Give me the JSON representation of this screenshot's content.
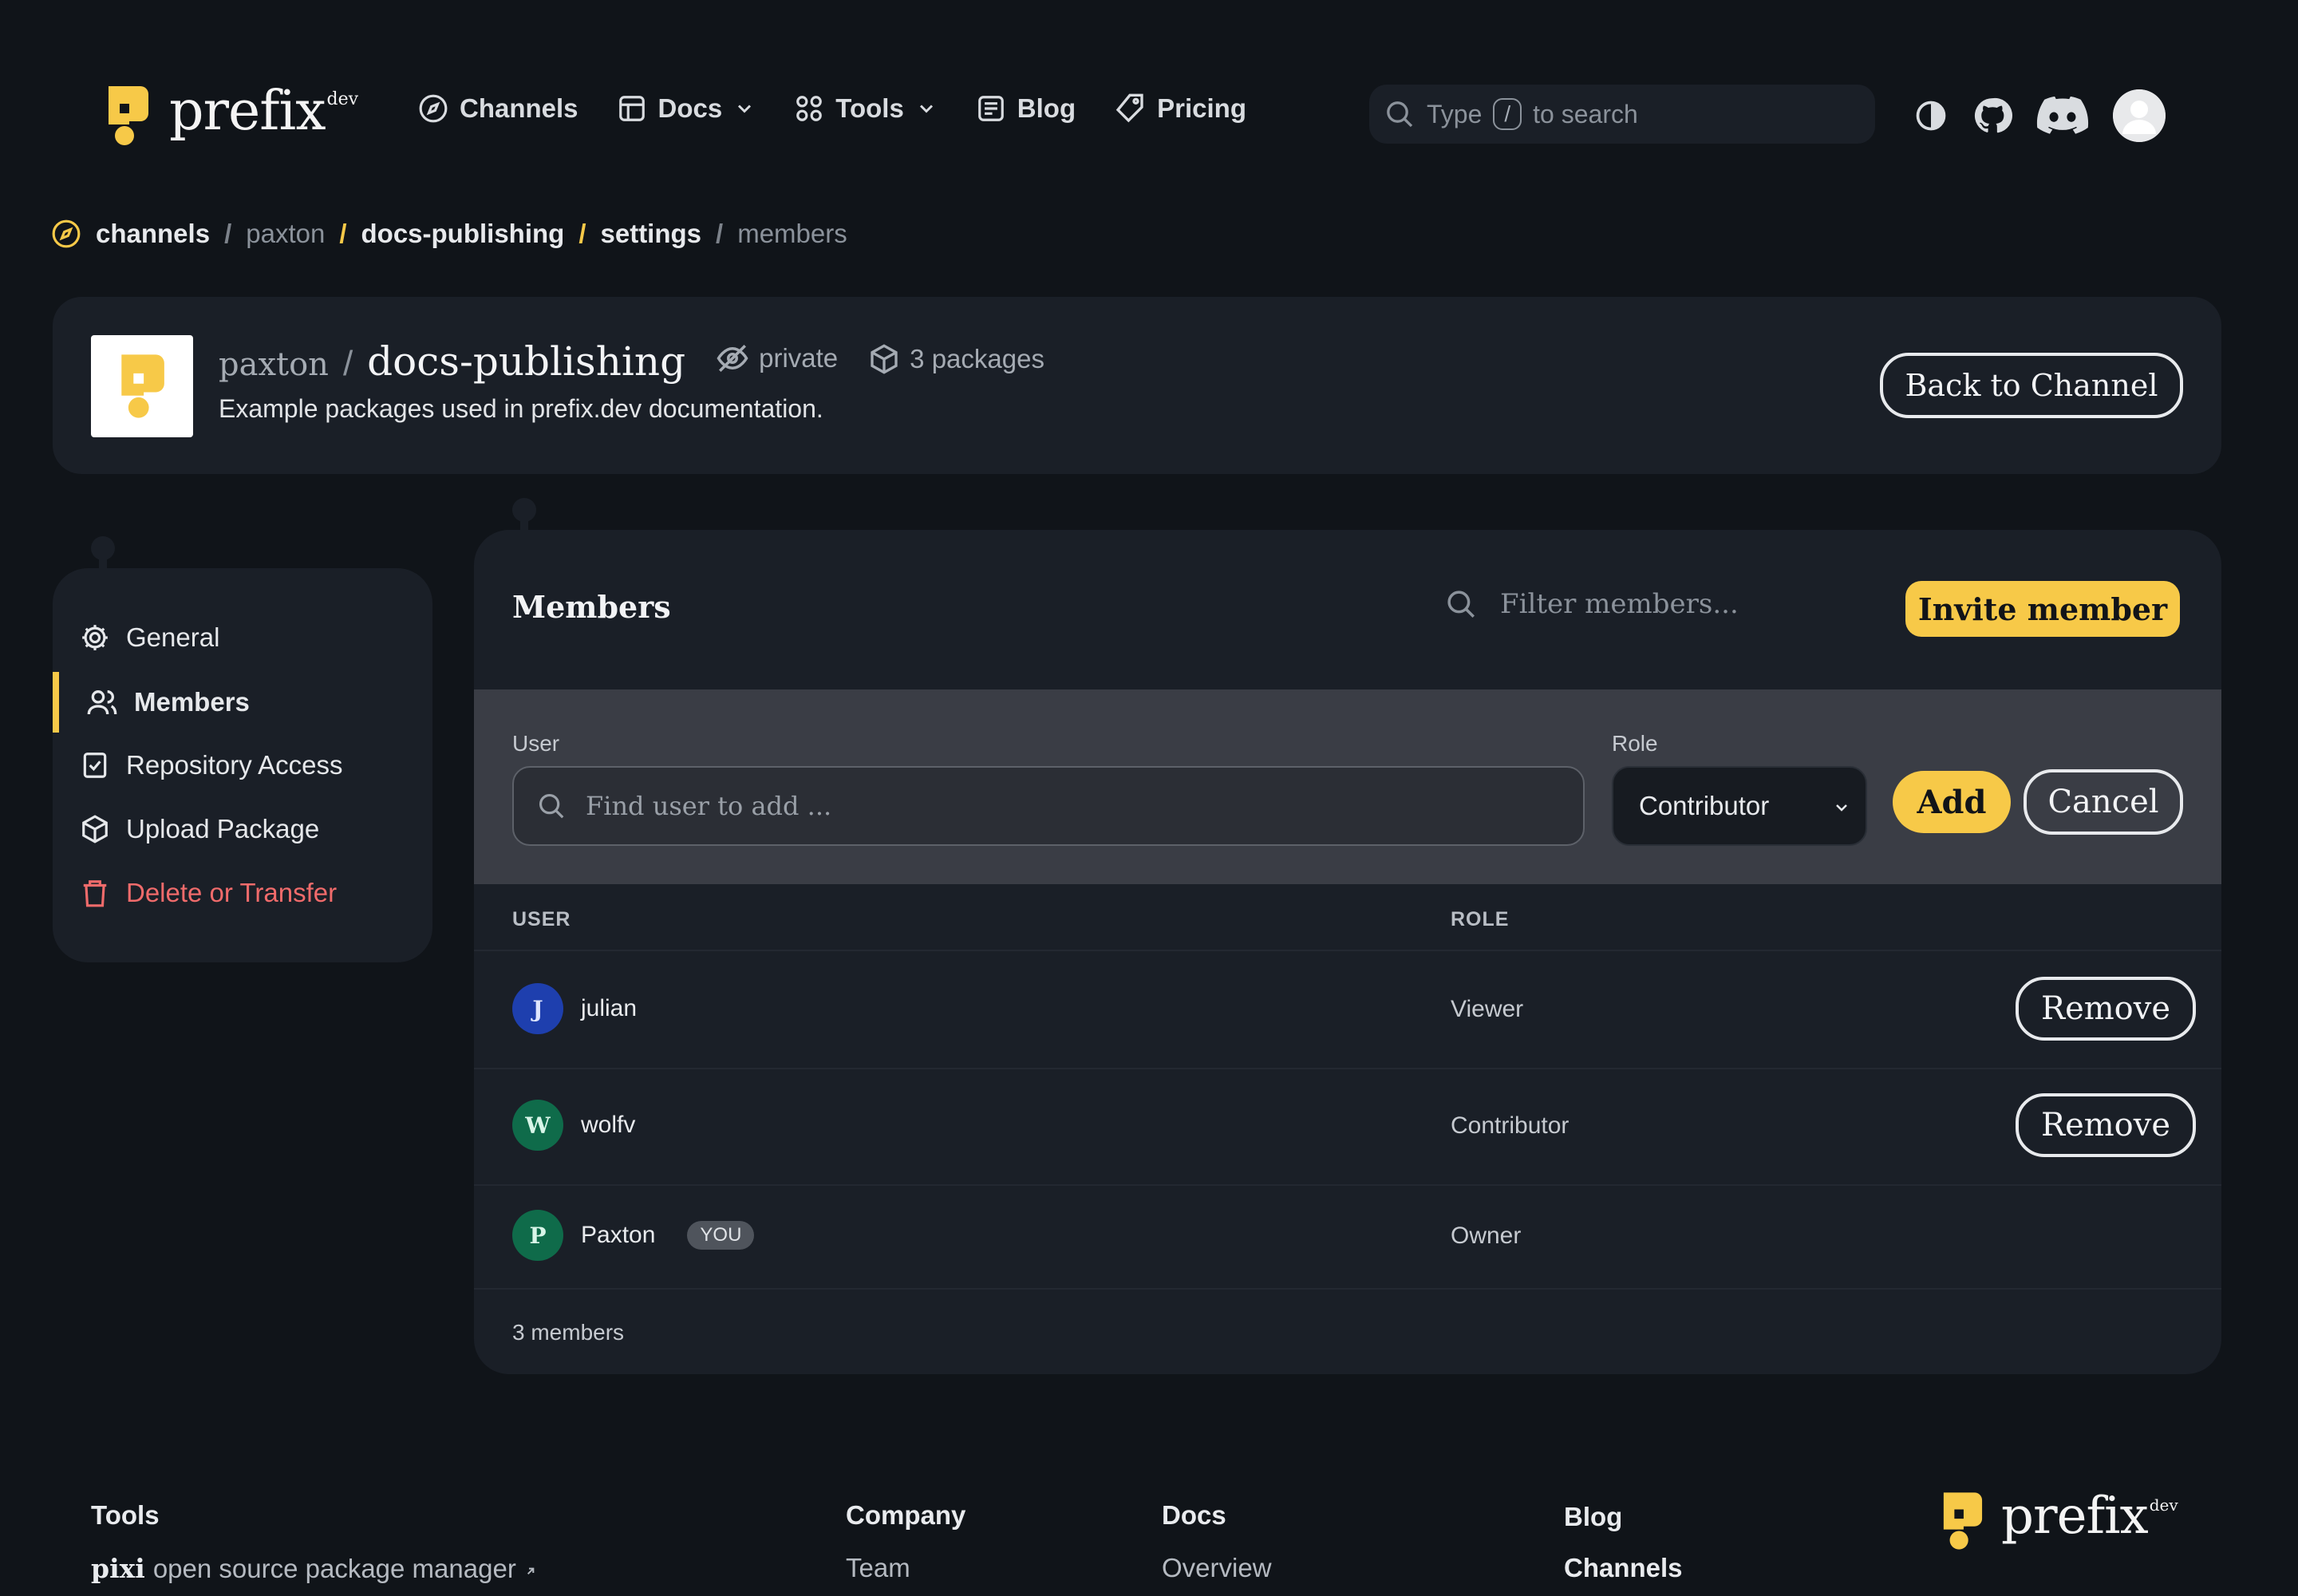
{
  "brand": {
    "name": "prefix",
    "sup": "dev",
    "accent": "#f7c948"
  },
  "nav": {
    "items": [
      {
        "label": "Channels",
        "icon": "compass-icon"
      },
      {
        "label": "Docs",
        "icon": "book-icon"
      },
      {
        "label": "Tools",
        "icon": "grid-icon"
      },
      {
        "label": "Blog",
        "icon": "newspaper-icon"
      },
      {
        "label": "Pricing",
        "icon": "tag-icon"
      }
    ],
    "search_prefix": "Type",
    "search_key": "/",
    "search_suffix": "to search"
  },
  "breadcrumb": [
    "channels",
    "paxton",
    "docs-publishing",
    "settings",
    "members"
  ],
  "channel": {
    "owner": "paxton",
    "name": "docs-publishing",
    "visibility": "private",
    "packages": "3 packages",
    "description": "Example packages used in prefix.dev documentation.",
    "back_label": "Back to Channel"
  },
  "sidebar": {
    "items": [
      {
        "label": "General",
        "icon": "gear-icon"
      },
      {
        "label": "Members",
        "icon": "users-icon"
      },
      {
        "label": "Repository Access",
        "icon": "clipboard-check-icon"
      },
      {
        "label": "Upload Package",
        "icon": "package-icon"
      },
      {
        "label": "Delete or Transfer",
        "icon": "trash-icon"
      }
    ],
    "active": "Members"
  },
  "members": {
    "title": "Members",
    "filter_placeholder": "Filter members...",
    "invite_label": "Invite member",
    "add_form": {
      "user_label": "User",
      "user_placeholder": "Find user to add ...",
      "role_label": "Role",
      "role_value": "Contributor",
      "add_label": "Add",
      "cancel_label": "Cancel"
    },
    "columns": [
      "USER",
      "ROLE"
    ],
    "rows": [
      {
        "initial": "J",
        "name": "julian",
        "role": "Viewer",
        "action": "Remove",
        "avatar_color": "#1e3fae"
      },
      {
        "initial": "W",
        "name": "wolfv",
        "role": "Contributor",
        "action": "Remove",
        "avatar_color": "#0f6b4a"
      },
      {
        "initial": "P",
        "name": "Paxton",
        "badge": "YOU",
        "role": "Owner",
        "avatar_color": "#0f6b4a"
      }
    ],
    "count": "3 members"
  },
  "footer": {
    "tools_heading": "Tools",
    "tools_link_bold": "pixi",
    "tools_link_text": "open source package manager",
    "company_heading": "Company",
    "company_link": "Team",
    "docs_heading": "Docs",
    "docs_link": "Overview",
    "blog_heading": "Blog",
    "blog_link": "Channels"
  }
}
